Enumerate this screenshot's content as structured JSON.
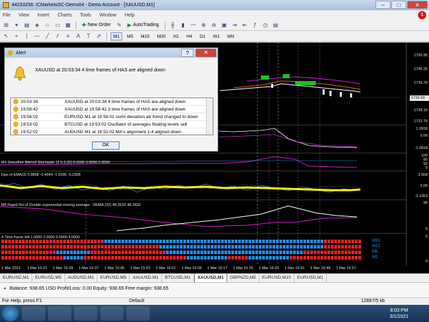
{
  "window": {
    "title": "44233256: ICMarketsSC-Demo04 - Demo Account - [XAUUSD,M1]",
    "controls": [
      "–",
      "□",
      "✕"
    ]
  },
  "menu": {
    "items": [
      "File",
      "View",
      "Insert",
      "Charts",
      "Tools",
      "Window",
      "Help"
    ],
    "notification_count": "1"
  },
  "toolbar": {
    "new_order": "New Order",
    "autotrading": "AutoTrading",
    "timeframes": [
      "M1",
      "M5",
      "M15",
      "M30",
      "H1",
      "H4",
      "D1",
      "W1",
      "MN"
    ],
    "active_timeframe": "M1"
  },
  "alert_dialog": {
    "title": "Alert",
    "help": "?",
    "close": "✕",
    "message": "XAUUSD at 20:03:34 4 time frames of HAS are aligned down",
    "rows": [
      {
        "time": "20:03:34",
        "message": "XAUUSD at 20:03:34 4 time frames of HAS are aligned down"
      },
      {
        "time": "19:58:42",
        "message": "XAUUSD at 19:58:42 3 time frames of HAS are aligned down"
      },
      {
        "time": "19:56:02",
        "message": "EURUSD M1 at 19:56:01 norm deviation atr trend changed to down"
      },
      {
        "time": "19:53:02",
        "message": "BTCUSD at 19:53:02 Oscillator of averages floating levels sell"
      },
      {
        "time": "19:52:02",
        "message": "AUDUSD M1 at 19:52:02 MA's alignment 1-4 aligned down"
      }
    ],
    "ok": "OK"
  },
  "chart": {
    "price_labels": [
      "1750.95",
      "1745.25",
      "1739.70",
      "1733.90",
      "1728.10",
      "1722.75"
    ],
    "current_price": "1733.90",
    "panel_labels": {
      "stochastic": "M1 Smoother filtered Stochastic (2.5,3,32) 0.0000 0.0000 0.0000",
      "dpo": "Dpo of EMA(3) 0.9898 -0.4644 -1.9185 -0.2308",
      "rsi": "M5 Rapid Rsi of Double exponential moving average - DEMA (32) 48.2632 48.2632",
      "has": "4 Time frame HA 1.0000 2.0000 3.0000 4.0000"
    },
    "osc_labels": [
      "1.0918",
      "0.00",
      "-1.0918"
    ],
    "stoch_labels": [
      "100",
      "80",
      "50",
      "20",
      "0"
    ],
    "dpo_labels": [
      "2.568",
      "0.00",
      "-2.1353"
    ],
    "rsi_labels": [
      "95",
      "5"
    ],
    "has_labels": [
      "5",
      "0"
    ],
    "timeframe_rows": [
      "M30",
      "M15",
      "M5",
      "M1"
    ],
    "time_labels": [
      "1 Mar 2021",
      "1 Mar 15:21",
      "1 Mar 15:29",
      "1 Mar 15:37",
      "1 Mar 15:45",
      "1 Mar 15:53",
      "1 Mar 16:01",
      "1 Mar 16:09",
      "1 Mar 16:17",
      "1 Mar 16:25",
      "1 Mar 16:33",
      "1 Mar 16:41",
      "1 Mar 16:49",
      "1 Mar 16:57"
    ]
  },
  "tabs": [
    "EURUSD,M1",
    "EURUSD,M5",
    "AUDUSD,M1",
    "EURUSD,M5",
    "XAUUSD,M1",
    "BTCUSD,M1",
    "XAUUSD,M1",
    "GBPNZD,M5",
    "EURUSD,M15",
    "EURUSD,M1"
  ],
  "active_tab_index": 6,
  "terminal": {
    "balance_line": "Balance: 938.65 USD  Profit/Loss: 0.00  Equity: 938.65  Free margin: 938.65"
  },
  "statusbar": {
    "help": "For Help, press F1",
    "profile": "Default",
    "traffic": "12887/5 kb"
  },
  "taskbar": {
    "time": "8:03 PM",
    "date": "3/1/2021"
  },
  "colors": {
    "chart_bg": "#000000",
    "bull": "#1e90ff",
    "bear": "#ff2020",
    "ma_yellow": "#f5f500",
    "magenta": "#e000e0"
  }
}
